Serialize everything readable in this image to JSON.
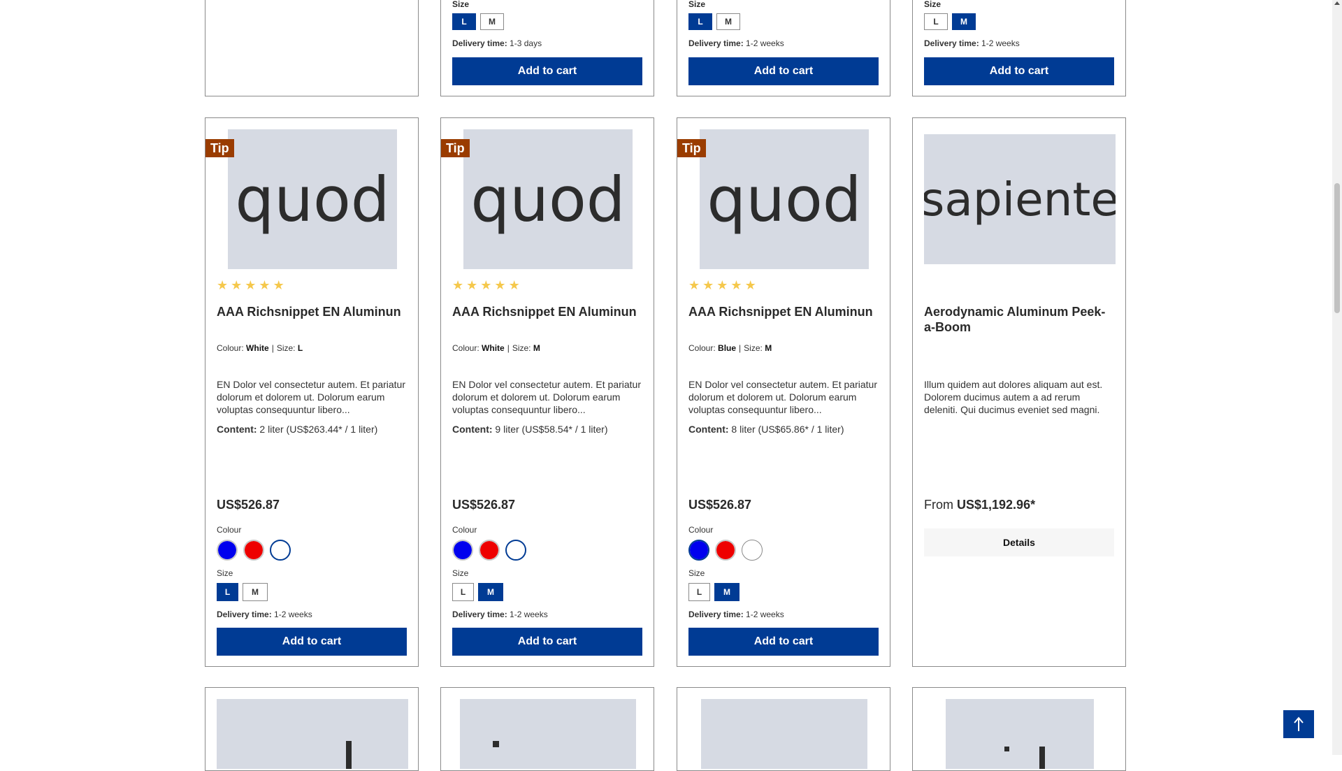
{
  "top_row": [
    {},
    {
      "size_label": "Size",
      "sizes": [
        {
          "label": "L",
          "active": true
        },
        {
          "label": "M",
          "active": false
        }
      ],
      "delivery_label": "Delivery time:",
      "delivery_value": " 1-3 days",
      "cart_label": "Add to cart"
    },
    {
      "size_label": "Size",
      "sizes": [
        {
          "label": "L",
          "active": true
        },
        {
          "label": "M",
          "active": false
        }
      ],
      "delivery_label": "Delivery time:",
      "delivery_value": " 1-2 weeks",
      "cart_label": "Add to cart"
    },
    {
      "size_label": "Size",
      "sizes": [
        {
          "label": "L",
          "active": false
        },
        {
          "label": "M",
          "active": true
        }
      ],
      "delivery_label": "Delivery time:",
      "delivery_value": " 1-2 weeks",
      "cart_label": "Add to cart"
    }
  ],
  "products": [
    {
      "badge": "Tip",
      "image_text": "quod",
      "rating": 5,
      "title": "AAA Richsnippet EN Aluminun",
      "colour_label": "Colour:",
      "colour_value": "White",
      "size_label": "Size:",
      "size_value": "L",
      "description": "EN Dolor vel consectetur autem. Et pariatur dolorum et dolorem ut. Dolorum earum voluptas consequuntur libero...",
      "content_label": "Content:",
      "content_value": " 2 liter (US$263.44* / 1 liter)",
      "price": "US$526.87",
      "swatch_label": "Colour",
      "swatches": [
        {
          "color": "#0000ee",
          "selected": false
        },
        {
          "color": "#ee0000",
          "selected": false
        },
        {
          "color": "#ffffff",
          "selected": true
        }
      ],
      "sizes_label": "Size",
      "sizes": [
        {
          "label": "L",
          "active": true
        },
        {
          "label": "M",
          "active": false
        }
      ],
      "delivery_label": "Delivery time:",
      "delivery_value": " 1-2 weeks",
      "cart_label": "Add to cart"
    },
    {
      "badge": "Tip",
      "image_text": "quod",
      "rating": 5,
      "title": "AAA Richsnippet EN Aluminun",
      "colour_label": "Colour:",
      "colour_value": "White",
      "size_label": "Size:",
      "size_value": "M",
      "description": "EN Dolor vel consectetur autem. Et pariatur dolorum et dolorem ut. Dolorum earum voluptas consequuntur libero...",
      "content_label": "Content:",
      "content_value": " 9 liter (US$58.54* / 1 liter)",
      "price": "US$526.87",
      "swatch_label": "Colour",
      "swatches": [
        {
          "color": "#0000ee",
          "selected": false
        },
        {
          "color": "#ee0000",
          "selected": false
        },
        {
          "color": "#ffffff",
          "selected": true
        }
      ],
      "sizes_label": "Size",
      "sizes": [
        {
          "label": "L",
          "active": false
        },
        {
          "label": "M",
          "active": true
        }
      ],
      "delivery_label": "Delivery time:",
      "delivery_value": " 1-2 weeks",
      "cart_label": "Add to cart"
    },
    {
      "badge": "Tip",
      "image_text": "quod",
      "rating": 5,
      "title": "AAA Richsnippet EN Aluminun",
      "colour_label": "Colour:",
      "colour_value": "Blue",
      "size_label": "Size:",
      "size_value": "M",
      "description": "EN Dolor vel consectetur autem. Et pariatur dolorum et dolorem ut. Dolorum earum voluptas consequuntur libero...",
      "content_label": "Content:",
      "content_value": " 8 liter (US$65.86* / 1 liter)",
      "price": "US$526.87",
      "swatch_label": "Colour",
      "swatches": [
        {
          "color": "#0000ee",
          "selected": true
        },
        {
          "color": "#ee0000",
          "selected": false
        },
        {
          "color": "#ffffff",
          "selected": false
        }
      ],
      "sizes_label": "Size",
      "sizes": [
        {
          "label": "L",
          "active": false
        },
        {
          "label": "M",
          "active": true
        }
      ],
      "delivery_label": "Delivery time:",
      "delivery_value": " 1-2 weeks",
      "cart_label": "Add to cart"
    },
    {
      "badge": "",
      "image_text": "sapiente",
      "title": "Aerodynamic Aluminum Peek-a-Boom",
      "description": "Illum quidem aut dolores aliquam aut est. Dolorem ducimus autem a ad rerum deleniti. Qui ducimus eveniet sed magni.",
      "price_prefix": "From ",
      "price": "US$1,192.96*",
      "details_label": "Details"
    }
  ],
  "bottom_row_image_texts": [
    "",
    "",
    "",
    ""
  ],
  "colors": {
    "primary": "#003b94",
    "tip_badge": "#9a3c00",
    "star": "#f5c84c",
    "image_bg": "#d6dae3"
  },
  "icons": {
    "back_to_top": "arrow-up-icon",
    "star": "star-icon"
  }
}
